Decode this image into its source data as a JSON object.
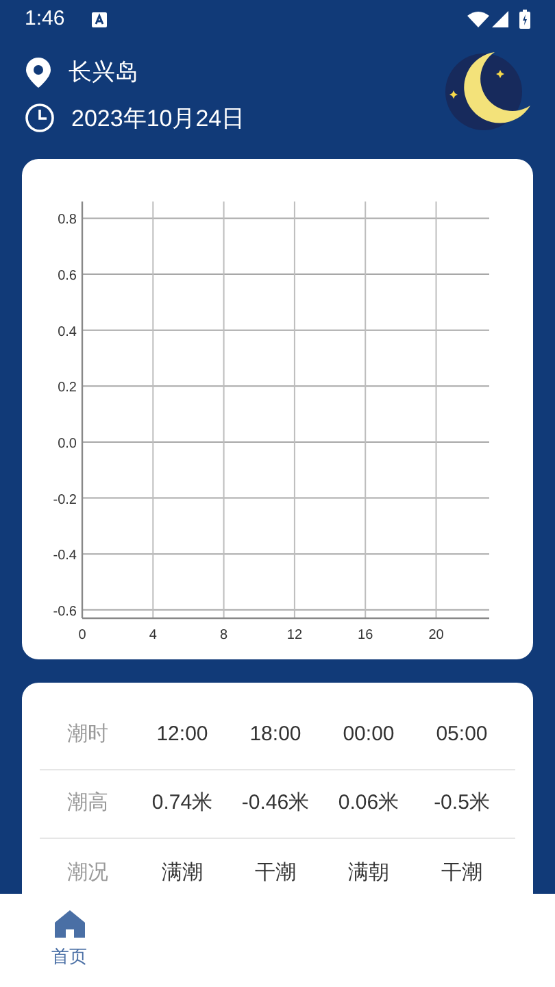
{
  "status_bar": {
    "time": "1:46"
  },
  "header": {
    "location": "长兴岛",
    "date": "2023年10月24日"
  },
  "tide_chart": {
    "chart_data": {
      "type": "line",
      "grid": true,
      "xlim": [
        0,
        23
      ],
      "ylim": [
        -0.63,
        0.86
      ],
      "xticks": [
        0,
        4,
        8,
        12,
        16,
        20
      ],
      "yticks": [
        {
          "value": 0.8,
          "label": "0.8"
        },
        {
          "value": 0.6,
          "label": "0.6"
        },
        {
          "value": 0.4,
          "label": "0.4"
        },
        {
          "value": 0.2,
          "label": "0.2"
        },
        {
          "value": 0,
          "label": "0.0"
        },
        {
          "value": -0.2,
          "label": "-0.2"
        },
        {
          "value": -0.4,
          "label": "-0.4"
        },
        {
          "value": -0.6,
          "label": "-0.6"
        }
      ]
    }
  },
  "tide_table": {
    "rows": [
      {
        "label": "潮时",
        "cells": [
          "12:00",
          "18:00",
          "00:00",
          "05:00"
        ]
      },
      {
        "label": "潮高",
        "cells": [
          "0.74米",
          "-0.46米",
          "0.06米",
          "-0.5米"
        ]
      },
      {
        "label": "潮况",
        "cells": [
          "满潮",
          "干潮",
          "满朝",
          "干潮"
        ]
      }
    ]
  },
  "bottom_nav": {
    "tabs": [
      {
        "label": "首页",
        "selected": true
      }
    ]
  }
}
